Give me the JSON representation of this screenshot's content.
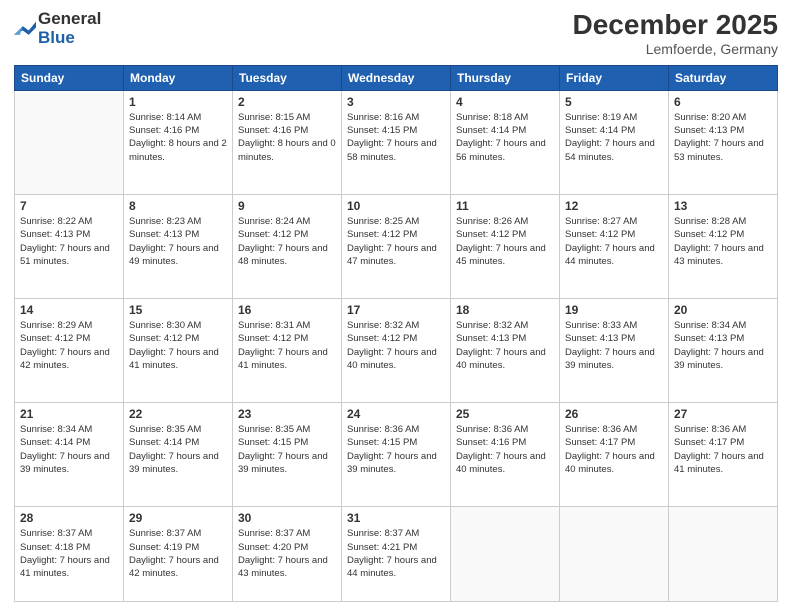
{
  "header": {
    "logo_general": "General",
    "logo_blue": "Blue",
    "title": "December 2025",
    "subtitle": "Lemfoerde, Germany"
  },
  "days_of_week": [
    "Sunday",
    "Monday",
    "Tuesday",
    "Wednesday",
    "Thursday",
    "Friday",
    "Saturday"
  ],
  "weeks": [
    [
      {
        "day": "",
        "sunrise": "",
        "sunset": "",
        "daylight": ""
      },
      {
        "day": "1",
        "sunrise": "Sunrise: 8:14 AM",
        "sunset": "Sunset: 4:16 PM",
        "daylight": "Daylight: 8 hours and 2 minutes."
      },
      {
        "day": "2",
        "sunrise": "Sunrise: 8:15 AM",
        "sunset": "Sunset: 4:16 PM",
        "daylight": "Daylight: 8 hours and 0 minutes."
      },
      {
        "day": "3",
        "sunrise": "Sunrise: 8:16 AM",
        "sunset": "Sunset: 4:15 PM",
        "daylight": "Daylight: 7 hours and 58 minutes."
      },
      {
        "day": "4",
        "sunrise": "Sunrise: 8:18 AM",
        "sunset": "Sunset: 4:14 PM",
        "daylight": "Daylight: 7 hours and 56 minutes."
      },
      {
        "day": "5",
        "sunrise": "Sunrise: 8:19 AM",
        "sunset": "Sunset: 4:14 PM",
        "daylight": "Daylight: 7 hours and 54 minutes."
      },
      {
        "day": "6",
        "sunrise": "Sunrise: 8:20 AM",
        "sunset": "Sunset: 4:13 PM",
        "daylight": "Daylight: 7 hours and 53 minutes."
      }
    ],
    [
      {
        "day": "7",
        "sunrise": "Sunrise: 8:22 AM",
        "sunset": "Sunset: 4:13 PM",
        "daylight": "Daylight: 7 hours and 51 minutes."
      },
      {
        "day": "8",
        "sunrise": "Sunrise: 8:23 AM",
        "sunset": "Sunset: 4:13 PM",
        "daylight": "Daylight: 7 hours and 49 minutes."
      },
      {
        "day": "9",
        "sunrise": "Sunrise: 8:24 AM",
        "sunset": "Sunset: 4:12 PM",
        "daylight": "Daylight: 7 hours and 48 minutes."
      },
      {
        "day": "10",
        "sunrise": "Sunrise: 8:25 AM",
        "sunset": "Sunset: 4:12 PM",
        "daylight": "Daylight: 7 hours and 47 minutes."
      },
      {
        "day": "11",
        "sunrise": "Sunrise: 8:26 AM",
        "sunset": "Sunset: 4:12 PM",
        "daylight": "Daylight: 7 hours and 45 minutes."
      },
      {
        "day": "12",
        "sunrise": "Sunrise: 8:27 AM",
        "sunset": "Sunset: 4:12 PM",
        "daylight": "Daylight: 7 hours and 44 minutes."
      },
      {
        "day": "13",
        "sunrise": "Sunrise: 8:28 AM",
        "sunset": "Sunset: 4:12 PM",
        "daylight": "Daylight: 7 hours and 43 minutes."
      }
    ],
    [
      {
        "day": "14",
        "sunrise": "Sunrise: 8:29 AM",
        "sunset": "Sunset: 4:12 PM",
        "daylight": "Daylight: 7 hours and 42 minutes."
      },
      {
        "day": "15",
        "sunrise": "Sunrise: 8:30 AM",
        "sunset": "Sunset: 4:12 PM",
        "daylight": "Daylight: 7 hours and 41 minutes."
      },
      {
        "day": "16",
        "sunrise": "Sunrise: 8:31 AM",
        "sunset": "Sunset: 4:12 PM",
        "daylight": "Daylight: 7 hours and 41 minutes."
      },
      {
        "day": "17",
        "sunrise": "Sunrise: 8:32 AM",
        "sunset": "Sunset: 4:12 PM",
        "daylight": "Daylight: 7 hours and 40 minutes."
      },
      {
        "day": "18",
        "sunrise": "Sunrise: 8:32 AM",
        "sunset": "Sunset: 4:13 PM",
        "daylight": "Daylight: 7 hours and 40 minutes."
      },
      {
        "day": "19",
        "sunrise": "Sunrise: 8:33 AM",
        "sunset": "Sunset: 4:13 PM",
        "daylight": "Daylight: 7 hours and 39 minutes."
      },
      {
        "day": "20",
        "sunrise": "Sunrise: 8:34 AM",
        "sunset": "Sunset: 4:13 PM",
        "daylight": "Daylight: 7 hours and 39 minutes."
      }
    ],
    [
      {
        "day": "21",
        "sunrise": "Sunrise: 8:34 AM",
        "sunset": "Sunset: 4:14 PM",
        "daylight": "Daylight: 7 hours and 39 minutes."
      },
      {
        "day": "22",
        "sunrise": "Sunrise: 8:35 AM",
        "sunset": "Sunset: 4:14 PM",
        "daylight": "Daylight: 7 hours and 39 minutes."
      },
      {
        "day": "23",
        "sunrise": "Sunrise: 8:35 AM",
        "sunset": "Sunset: 4:15 PM",
        "daylight": "Daylight: 7 hours and 39 minutes."
      },
      {
        "day": "24",
        "sunrise": "Sunrise: 8:36 AM",
        "sunset": "Sunset: 4:15 PM",
        "daylight": "Daylight: 7 hours and 39 minutes."
      },
      {
        "day": "25",
        "sunrise": "Sunrise: 8:36 AM",
        "sunset": "Sunset: 4:16 PM",
        "daylight": "Daylight: 7 hours and 40 minutes."
      },
      {
        "day": "26",
        "sunrise": "Sunrise: 8:36 AM",
        "sunset": "Sunset: 4:17 PM",
        "daylight": "Daylight: 7 hours and 40 minutes."
      },
      {
        "day": "27",
        "sunrise": "Sunrise: 8:36 AM",
        "sunset": "Sunset: 4:17 PM",
        "daylight": "Daylight: 7 hours and 41 minutes."
      }
    ],
    [
      {
        "day": "28",
        "sunrise": "Sunrise: 8:37 AM",
        "sunset": "Sunset: 4:18 PM",
        "daylight": "Daylight: 7 hours and 41 minutes."
      },
      {
        "day": "29",
        "sunrise": "Sunrise: 8:37 AM",
        "sunset": "Sunset: 4:19 PM",
        "daylight": "Daylight: 7 hours and 42 minutes."
      },
      {
        "day": "30",
        "sunrise": "Sunrise: 8:37 AM",
        "sunset": "Sunset: 4:20 PM",
        "daylight": "Daylight: 7 hours and 43 minutes."
      },
      {
        "day": "31",
        "sunrise": "Sunrise: 8:37 AM",
        "sunset": "Sunset: 4:21 PM",
        "daylight": "Daylight: 7 hours and 44 minutes."
      },
      {
        "day": "",
        "sunrise": "",
        "sunset": "",
        "daylight": ""
      },
      {
        "day": "",
        "sunrise": "",
        "sunset": "",
        "daylight": ""
      },
      {
        "day": "",
        "sunrise": "",
        "sunset": "",
        "daylight": ""
      }
    ]
  ]
}
